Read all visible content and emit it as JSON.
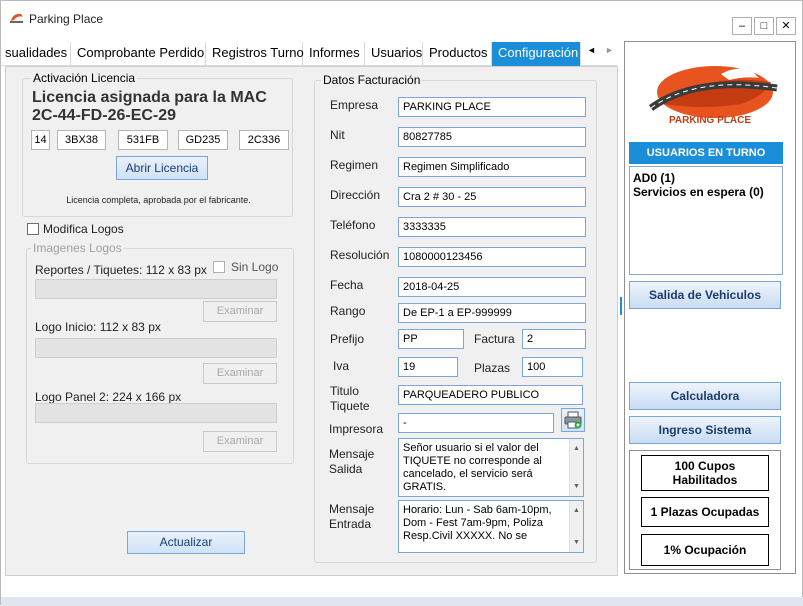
{
  "window": {
    "title": "Parking Place",
    "minimize": "–",
    "maximize": "□",
    "close": "✕"
  },
  "tabs": [
    {
      "label": "sualidades"
    },
    {
      "label": "Comprobante Perdido"
    },
    {
      "label": "Registros Turno"
    },
    {
      "label": "Informes"
    },
    {
      "label": "Usuarios"
    },
    {
      "label": "Productos"
    },
    {
      "label": "Configuración"
    }
  ],
  "license": {
    "group_title": "Activación Licencia",
    "heading": "Licencia asignada para la MAC",
    "mac": "2C-44-FD-26-EC-29",
    "codes": [
      "14",
      "3BX38",
      "531FB",
      "GD235",
      "2C336"
    ],
    "open_button": "Abrir Licencia",
    "status": "Licencia completa, aprobada por el fabricante."
  },
  "logos": {
    "modify_label": "Modifica Logos",
    "group_title": "Imagenes Logos",
    "reportes_label": "Reportes / Tiquetes: 112 x 83 px",
    "sin_logo": "Sin Logo",
    "inicio_label": "Logo Inicio: 112 x 83 px",
    "panel_label": "Logo Panel 2: 224 x 166 px",
    "examinar": "Examinar"
  },
  "update_button": "Actualizar",
  "billing": {
    "group_title": "Datos Facturación",
    "empresa": {
      "label": "Empresa",
      "value": "PARKING PLACE"
    },
    "nit": {
      "label": "Nit",
      "value": "80827785"
    },
    "regimen": {
      "label": "Regimen",
      "value": "Regimen Simplificado"
    },
    "direccion": {
      "label": "Dirección",
      "value": "Cra 2 # 30 - 25"
    },
    "telefono": {
      "label": "Teléfono",
      "value": "3333335"
    },
    "resolucion": {
      "label": "Resolución",
      "value": "1080000123456"
    },
    "fecha": {
      "label": "Fecha",
      "value": "2018-04-25"
    },
    "rango": {
      "label": "Rango",
      "value": "De EP-1 a EP-999999"
    },
    "prefijo": {
      "label": "Prefijo",
      "value": "PP"
    },
    "factura": {
      "label": "Factura",
      "value": "2"
    },
    "iva": {
      "label": "Iva",
      "value": "19"
    },
    "plazas": {
      "label": "Plazas",
      "value": "100"
    },
    "titulo": {
      "label1": "Titulo",
      "label2": "Tiquete",
      "value": "PARQUEADERO PUBLICO"
    },
    "impresora": {
      "label": "Impresora",
      "value": "-"
    },
    "mensaje_salida": {
      "label1": "Mensaje",
      "label2": "Salida",
      "value": "Señor usuario si el valor del TIQUETE no corresponde al cancelado, el servicio será GRATIS."
    },
    "mensaje_entrada": {
      "label1": "Mensaje",
      "label2": "Entrada",
      "value": "Horario: Lun - Sab 6am-10pm, Dom - Fest 7am-9pm, Poliza Resp.Civil XXXXX. No se"
    }
  },
  "side": {
    "logo_text": "PARKING PLACE",
    "users_header": "USUARIOS EN TURNO",
    "users": [
      "AD0 (1)",
      "Servicios en espera (0)"
    ],
    "salida_button": "Salida de Vehiculos",
    "calculadora_button": "Calculadora",
    "ingreso_button": "Ingreso Sistema",
    "cupos": "100 Cupos Habilitados",
    "ocupadas": "1 Plazas Ocupadas",
    "ocupacion": "1% Ocupación"
  },
  "colors": {
    "accent": "#1a8ed8",
    "brand": "#e8541f",
    "header_blue": "#1a8ed8"
  }
}
